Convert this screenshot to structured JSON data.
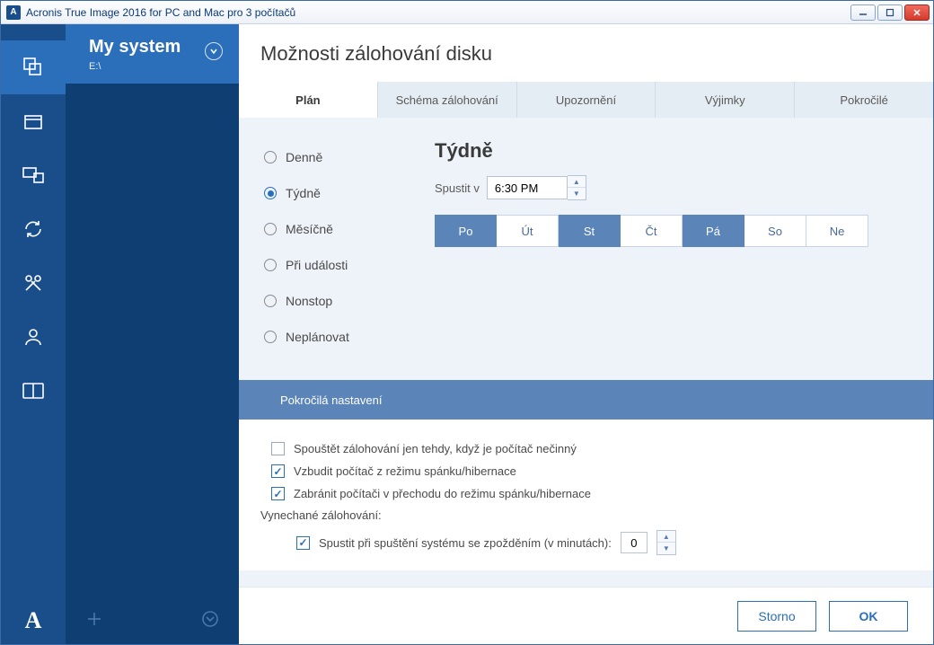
{
  "window": {
    "title": "Acronis True Image 2016 for PC and Mac pro 3 počítačů",
    "app_badge": "A"
  },
  "leftcol": {
    "name": "My system",
    "sub": "E:\\"
  },
  "main": {
    "heading": "Možnosti zálohování disku",
    "tabs": [
      "Plán",
      "Schéma zálohování",
      "Upozornění",
      "Výjimky",
      "Pokročilé"
    ]
  },
  "schedule": {
    "options": [
      "Denně",
      "Týdně",
      "Měsíčně",
      "Při události",
      "Nonstop",
      "Neplánovat"
    ],
    "selected": "Týdně"
  },
  "weekly": {
    "title": "Týdně",
    "start_label": "Spustit v",
    "time_value": "6:30 PM",
    "days": [
      {
        "abbr": "Po",
        "selected": true
      },
      {
        "abbr": "Út",
        "selected": false
      },
      {
        "abbr": "St",
        "selected": true
      },
      {
        "abbr": "Čt",
        "selected": false
      },
      {
        "abbr": "Pá",
        "selected": true
      },
      {
        "abbr": "So",
        "selected": false
      },
      {
        "abbr": "Ne",
        "selected": false
      }
    ]
  },
  "advanced": {
    "bar_label": "Pokročilá nastavení",
    "idle": {
      "label": "Spouštět zálohování jen tehdy, když je počítač nečinný",
      "checked": false
    },
    "wake": {
      "label": "Vzbudit počítač z režimu spánku/hibernace",
      "checked": true
    },
    "prevent": {
      "label": "Zabránit počítači v přechodu do režimu spánku/hibernace",
      "checked": true
    },
    "missed_label": "Vynechané zálohování:",
    "delay": {
      "label": "Spustit při spuštění systému se zpožděním (v minutách):",
      "checked": true,
      "value": "0"
    }
  },
  "footer": {
    "cancel": "Storno",
    "ok": "OK"
  }
}
